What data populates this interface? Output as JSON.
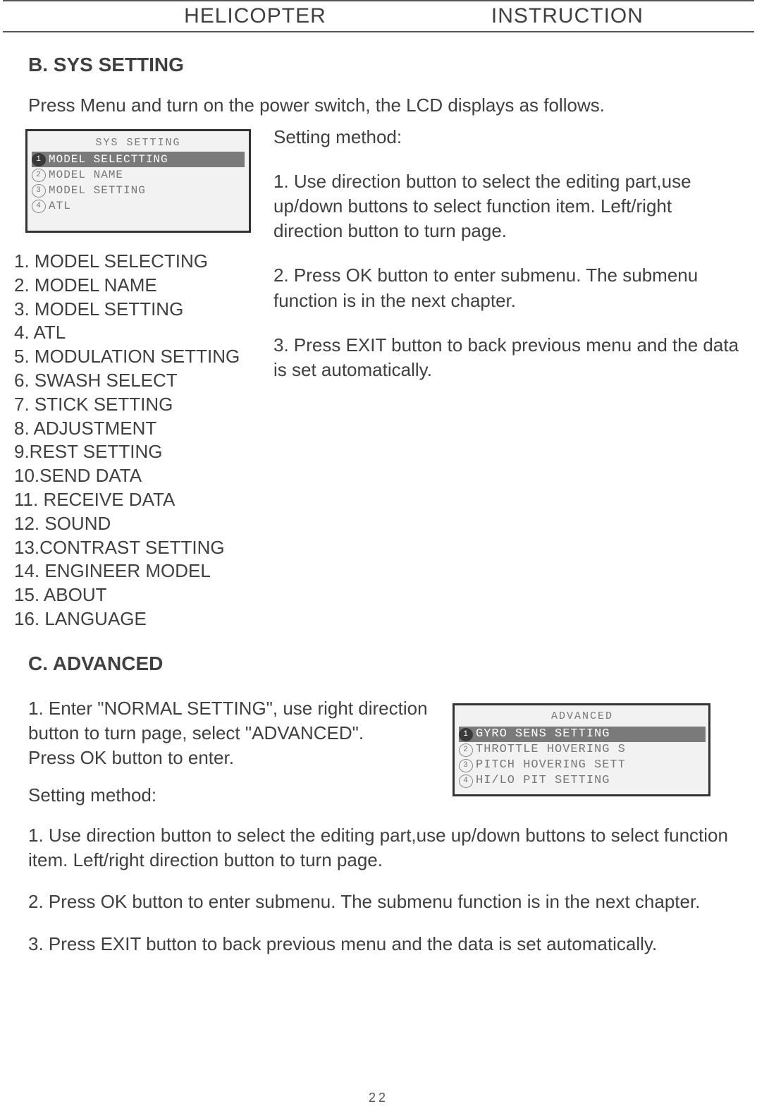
{
  "header": {
    "left": "HELICOPTER",
    "right": "INSTRUCTION"
  },
  "sectionB": {
    "title": "B. SYS SETTING",
    "intro": "Press Menu and turn on the power switch, the LCD displays as follows.",
    "lcd": {
      "title": "SYS SETTING",
      "items": [
        {
          "n": "1",
          "label": "MODEL SELECTTING",
          "selected": true
        },
        {
          "n": "2",
          "label": "MODEL NAME",
          "selected": false
        },
        {
          "n": "3",
          "label": "MODEL SETTING",
          "selected": false
        },
        {
          "n": "4",
          "label": "ATL",
          "selected": false
        }
      ]
    },
    "list": [
      "1. MODEL SELECTING",
      "2. MODEL NAME",
      "3. MODEL SETTING",
      "4. ATL",
      "5. MODULATION SETTING",
      "6. SWASH SELECT",
      "7. STICK SETTING",
      "8. ADJUSTMENT",
      "9.REST SETTING",
      "10.SEND DATA",
      "11. RECEIVE DATA",
      "12. SOUND",
      "13.CONTRAST SETTING",
      "14. ENGINEER MODEL",
      "15. ABOUT",
      "16. LANGUAGE"
    ],
    "method": {
      "title": "Setting method:",
      "step1": "1. Use direction button to select the editing part,use up/down buttons to select function item. Left/right direction button to turn page.",
      "step2": "2. Press OK button to enter submenu. The submenu function is in the next chapter.",
      "step3": "3. Press EXIT button to back previous menu and the data is set automatically."
    }
  },
  "sectionC": {
    "title": "C. ADVANCED",
    "intro1": "1. Enter \"NORMAL SETTING\", use right direction button to turn page, select \"ADVANCED\".",
    "intro2": "Press OK button to enter.",
    "lcd": {
      "title": "ADVANCED",
      "items": [
        {
          "n": "1",
          "label": "GYRO SENS SETTING",
          "selected": true
        },
        {
          "n": "2",
          "label": "THROTTLE HOVERING S",
          "selected": false
        },
        {
          "n": "3",
          "label": "PITCH HOVERING SETT",
          "selected": false
        },
        {
          "n": "4",
          "label": "HI/LO PIT SETTING",
          "selected": false
        }
      ]
    },
    "method": {
      "title": "Setting method:",
      "step1": "1. Use direction button to select the editing part,use up/down buttons to select function item. Left/right direction button to turn page.",
      "step2": "2. Press OK button to enter submenu. The submenu function is in the next chapter.",
      "step3": "3. Press EXIT button to back previous menu and the data is set automatically."
    }
  },
  "pageNumber": "22"
}
